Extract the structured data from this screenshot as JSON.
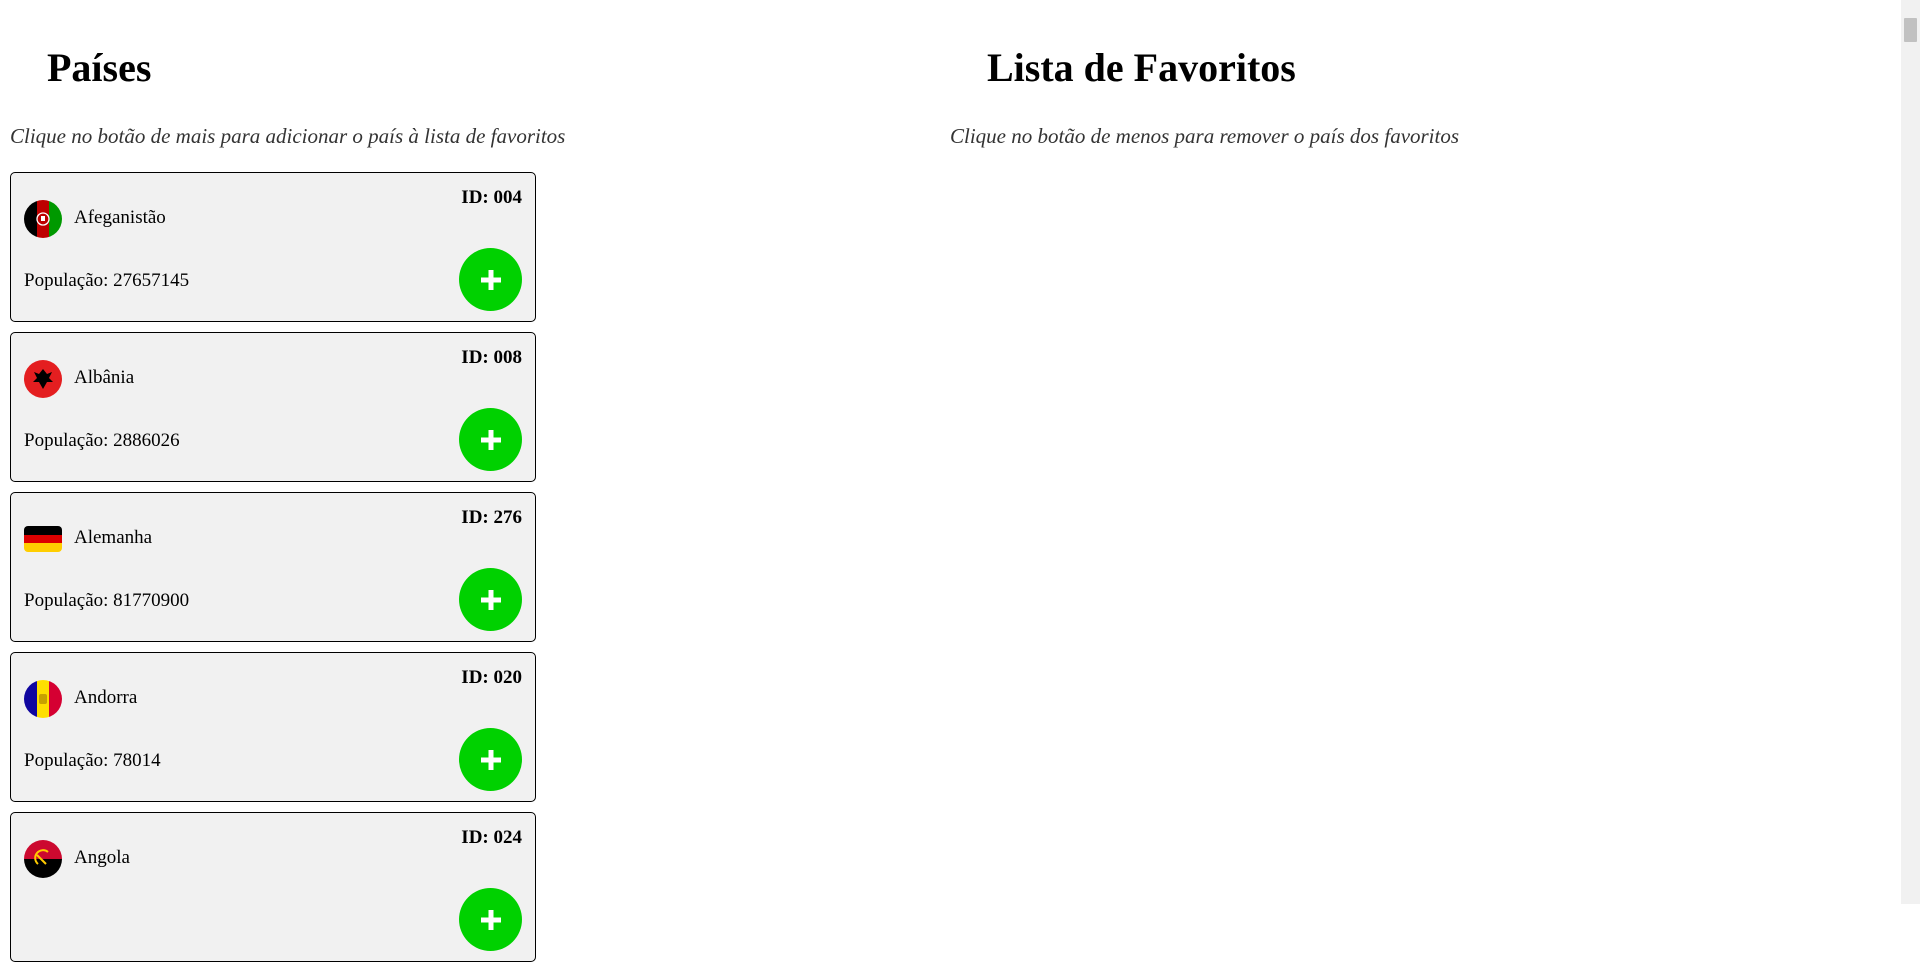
{
  "countries_section": {
    "title": "Países",
    "hint": "Clique no botão de mais para adicionar o país à lista de favoritos",
    "cards": [
      {
        "name": "Afeganistão",
        "id_label": "ID: 004",
        "population_label": "População: 27657145",
        "flag_icon": "afghanistan-flag-icon"
      },
      {
        "name": "Albânia",
        "id_label": "ID: 008",
        "population_label": "População: 2886026",
        "flag_icon": "albania-flag-icon"
      },
      {
        "name": "Alemanha",
        "id_label": "ID: 276",
        "population_label": "População: 81770900",
        "flag_icon": "germany-flag-icon"
      },
      {
        "name": "Andorra",
        "id_label": "ID: 020",
        "population_label": "População: 78014",
        "flag_icon": "andorra-flag-icon"
      },
      {
        "name": "Angola",
        "id_label": "ID: 024",
        "population_label": "",
        "flag_icon": "angola-flag-icon"
      }
    ],
    "add_button_icon": "plus-icon",
    "add_button_color": "#00d100"
  },
  "favorites_section": {
    "title": "Lista de Favoritos",
    "hint": "Clique no botão de menos para remover o país dos favoritos"
  }
}
